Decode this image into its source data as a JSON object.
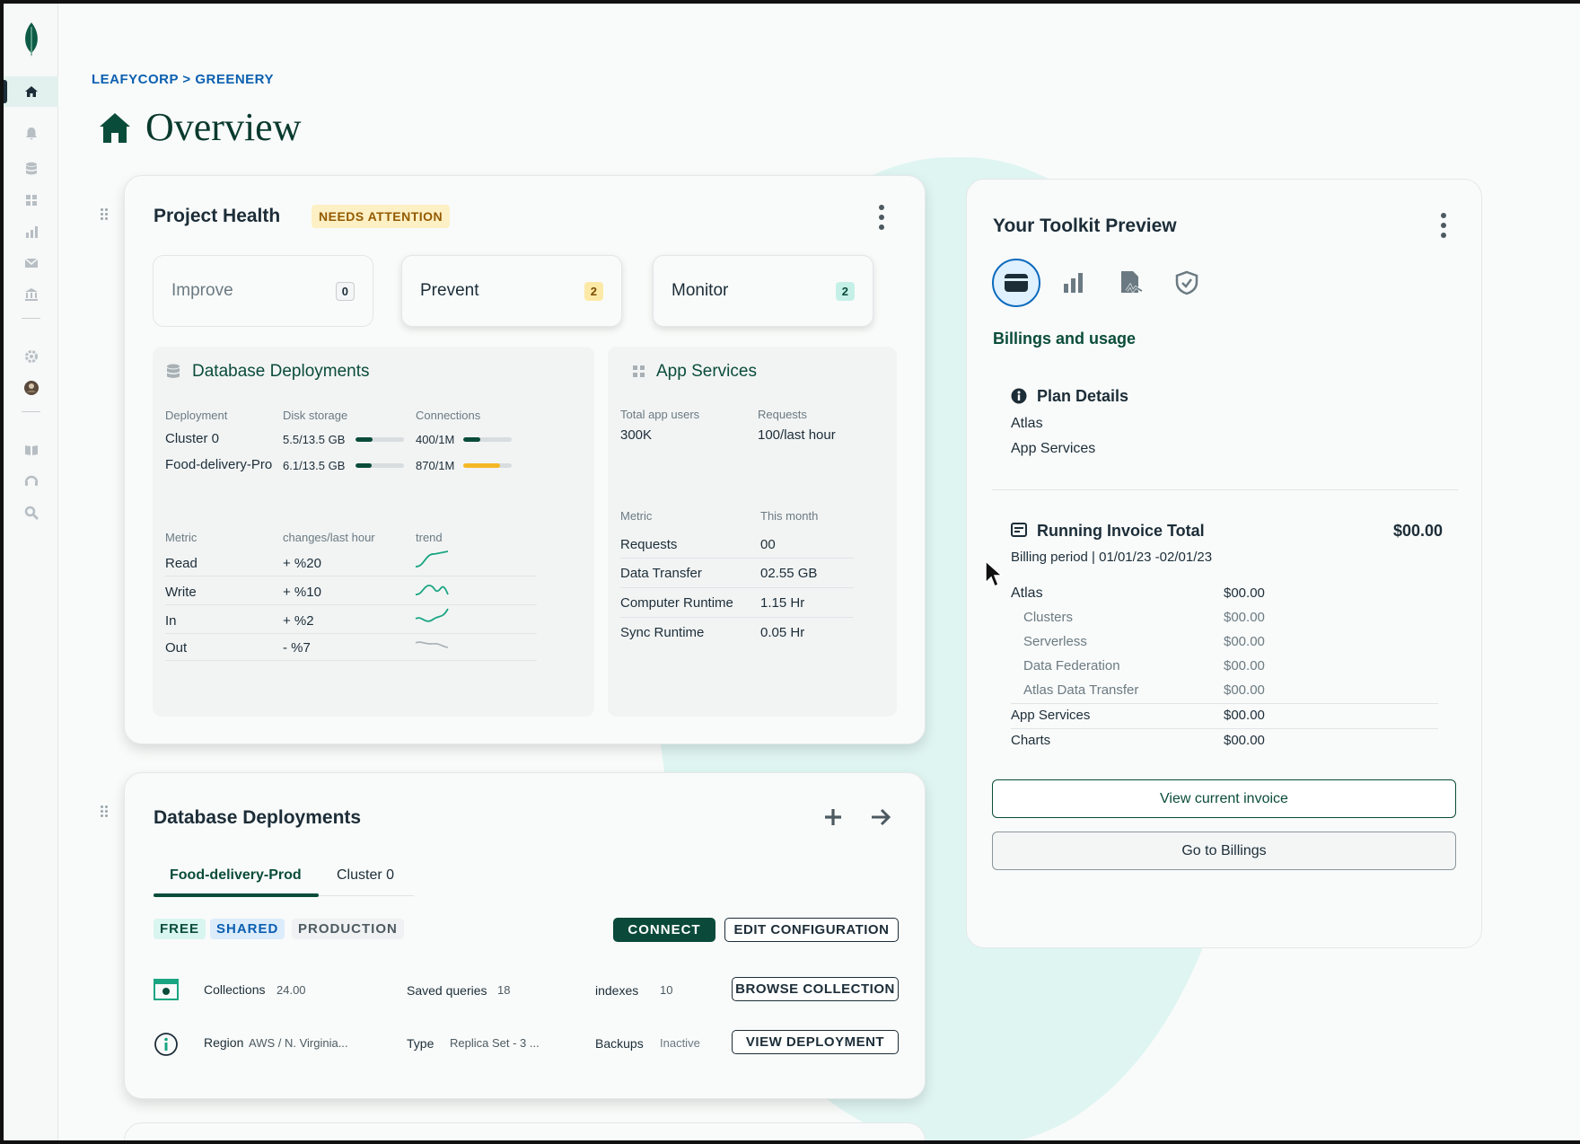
{
  "breadcrumb": "LEAFYCORP > GREENERY",
  "page_title": "Overview",
  "colors": {
    "brand": "#0a3a2e",
    "accent_green": "#0b4a3a",
    "link_blue": "#0b5fb0",
    "bar_green": "#0a4c3a",
    "bar_yellow": "#f5b825"
  },
  "sidebar": {
    "icons": [
      "leaf-logo-icon",
      "home-icon",
      "bell-icon",
      "database-icon",
      "apps-icon",
      "chart-icon",
      "mail-icon",
      "bank-icon",
      "gear-icon",
      "avatar",
      "book-icon",
      "support-icon",
      "search-icon"
    ]
  },
  "project_health": {
    "title": "Project Health",
    "status": "NEEDS ATTENTION",
    "tiles": [
      {
        "label": "Improve",
        "count": "0"
      },
      {
        "label": "Prevent",
        "count": "2"
      },
      {
        "label": "Monitor",
        "count": "2"
      }
    ],
    "db": {
      "title": "Database Deployments",
      "headers": [
        "Deployment",
        "Disk storage",
        "Connections"
      ],
      "rows": [
        {
          "name": "Cluster 0",
          "disk": "5.5/13.5 GB",
          "disk_fill": 0.35,
          "conn": "400/1M",
          "conn_fill": 0.35,
          "conn_color": "green"
        },
        {
          "name": "Food-delivery-Pro",
          "disk": "6.1/13.5 GB",
          "disk_fill": 0.33,
          "conn": "870/1M",
          "conn_fill": 0.75,
          "conn_color": "yellow"
        }
      ],
      "metric_headers": [
        "Metric",
        "changes/last hour",
        "trend"
      ],
      "metrics": [
        {
          "name": "Read",
          "change": "+ %20"
        },
        {
          "name": "Write",
          "change": "+ %10"
        },
        {
          "name": "In",
          "change": "+ %2"
        },
        {
          "name": "Out",
          "change": "- %7"
        }
      ]
    },
    "app": {
      "title": "App Services",
      "headers": [
        "Total app users",
        "Requests"
      ],
      "values": [
        "300K",
        "100/last hour"
      ],
      "metric_headers": [
        "Metric",
        "This month"
      ],
      "metrics": [
        {
          "name": "Requests",
          "value": "00"
        },
        {
          "name": "Data Transfer",
          "value": "02.55 GB"
        },
        {
          "name": "Computer Runtime",
          "value": "1.15 Hr"
        },
        {
          "name": "Sync Runtime",
          "value": "0.05 Hr"
        }
      ]
    }
  },
  "deployments": {
    "title": "Database Deployments",
    "tabs": [
      "Food-delivery-Prod",
      "Cluster 0"
    ],
    "chips": [
      "FREE",
      "SHARED",
      "PRODUCTION"
    ],
    "connect": "CONNECT",
    "edit": "EDIT CONFIGURATION",
    "row1": {
      "k1": "Collections",
      "v1": "24.00",
      "k2": "Saved queries",
      "v2": "18",
      "k3": "indexes",
      "v3": "10",
      "btn": "BROWSE COLLECTION"
    },
    "row2": {
      "k1": "Region",
      "v1": "AWS / N. Virginia...",
      "k2": "Type",
      "v2": "Replica Set - 3 ...",
      "k3": "Backups",
      "v3": "Inactive",
      "btn": "VIEW DEPLOYMENT"
    }
  },
  "toolkit": {
    "title": "Your Toolkit Preview",
    "icons": [
      "billing-card-icon",
      "bar-chart-icon",
      "document-signature-icon",
      "shield-icon"
    ],
    "section": "Billings and usage",
    "plan": {
      "title": "Plan Details",
      "items": [
        "Atlas",
        "App Services"
      ]
    },
    "invoice": {
      "title": "Running Invoice Total",
      "total": "$00.00",
      "period": "Billing period | 01/01/23 -02/01/23",
      "lines": [
        {
          "label": "Atlas",
          "value": "$00.00",
          "sub": false
        },
        {
          "label": "Clusters",
          "value": "$00.00",
          "sub": true
        },
        {
          "label": "Serverless",
          "value": "$00.00",
          "sub": true
        },
        {
          "label": "Data Federation",
          "value": "$00.00",
          "sub": true
        },
        {
          "label": "Atlas Data Transfer",
          "value": "$00.00",
          "sub": true
        },
        {
          "label": "App Services",
          "value": "$00.00",
          "sub": false
        },
        {
          "label": "Charts",
          "value": "$00.00",
          "sub": false
        }
      ]
    },
    "view_invoice": "View current invoice",
    "go_billings": "Go to Billings"
  }
}
